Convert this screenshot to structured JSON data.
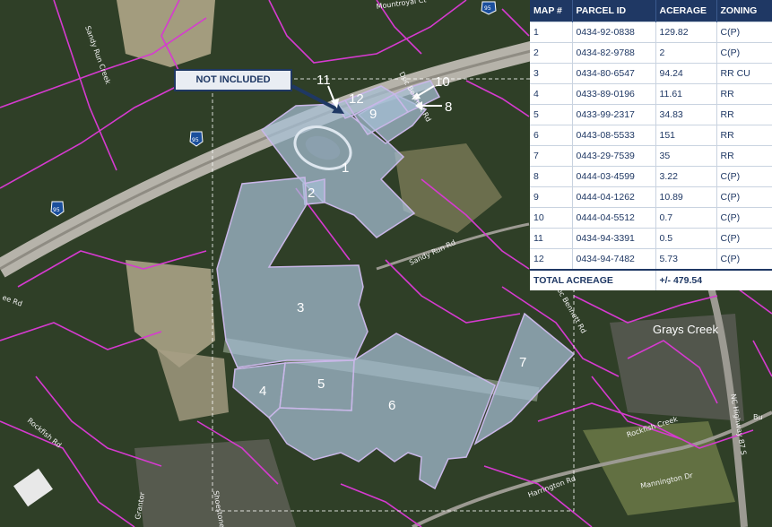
{
  "callout": {
    "label": "NOT INCLUDED"
  },
  "parcel_labels": [
    "1",
    "2",
    "3",
    "4",
    "5",
    "6",
    "7",
    "8",
    "9",
    "10",
    "11",
    "12"
  ],
  "roads": {
    "mountroyal": "Mountroyal Ct",
    "sandy_run_creek": "Sandy Run Creek",
    "sandy_run_rd": "Sandy Run Rd",
    "doc_bennett_top": "Doc Bennett Rd",
    "doc_bennett_mid": "Doc Bennett Rd",
    "harrington": "Harrington Rd",
    "mannington": "Mannington Dr",
    "rockfish_creek": "Rockfish Creek",
    "rockfish_rd": "Rockfish Rd",
    "nc87": "NC Highway 87 S",
    "shoestone": "Shoestone Dr",
    "grays_creek": "Grays Creek",
    "rd_left": "ee Rd",
    "bu": "Bu",
    "grantor": "Grantor"
  },
  "interstate_shield": "95",
  "table": {
    "headers": [
      "MAP #",
      "PARCEL ID",
      "ACERAGE",
      "ZONING"
    ],
    "rows": [
      [
        "1",
        "0434-92-0838",
        "129.82",
        "C(P)"
      ],
      [
        "2",
        "0434-82-9788",
        "2",
        "C(P)"
      ],
      [
        "3",
        "0434-80-6547",
        "94.24",
        "RR CU"
      ],
      [
        "4",
        "0433-89-0196",
        "11.61",
        "RR"
      ],
      [
        "5",
        "0433-99-2317",
        "34.83",
        "RR"
      ],
      [
        "6",
        "0443-08-5533",
        "151",
        "RR"
      ],
      [
        "7",
        "0443-29-7539",
        "35",
        "RR"
      ],
      [
        "8",
        "0444-03-4599",
        "3.22",
        "C(P)"
      ],
      [
        "9",
        "0444-04-1262",
        "10.89",
        "C(P)"
      ],
      [
        "10",
        "0444-04-5512",
        "0.7",
        "C(P)"
      ],
      [
        "11",
        "0434-94-3391",
        "0.5",
        "C(P)"
      ],
      [
        "12",
        "0434-94-7482",
        "5.73",
        "C(P)"
      ]
    ],
    "total_label": "TOTAL ACREAGE",
    "total_value": "+/- 479.54"
  },
  "colors": {
    "forest": "#2b3a24",
    "parcel_line": "#d63ad0",
    "overlay": "#a6bfd6",
    "header": "#1f3864"
  }
}
